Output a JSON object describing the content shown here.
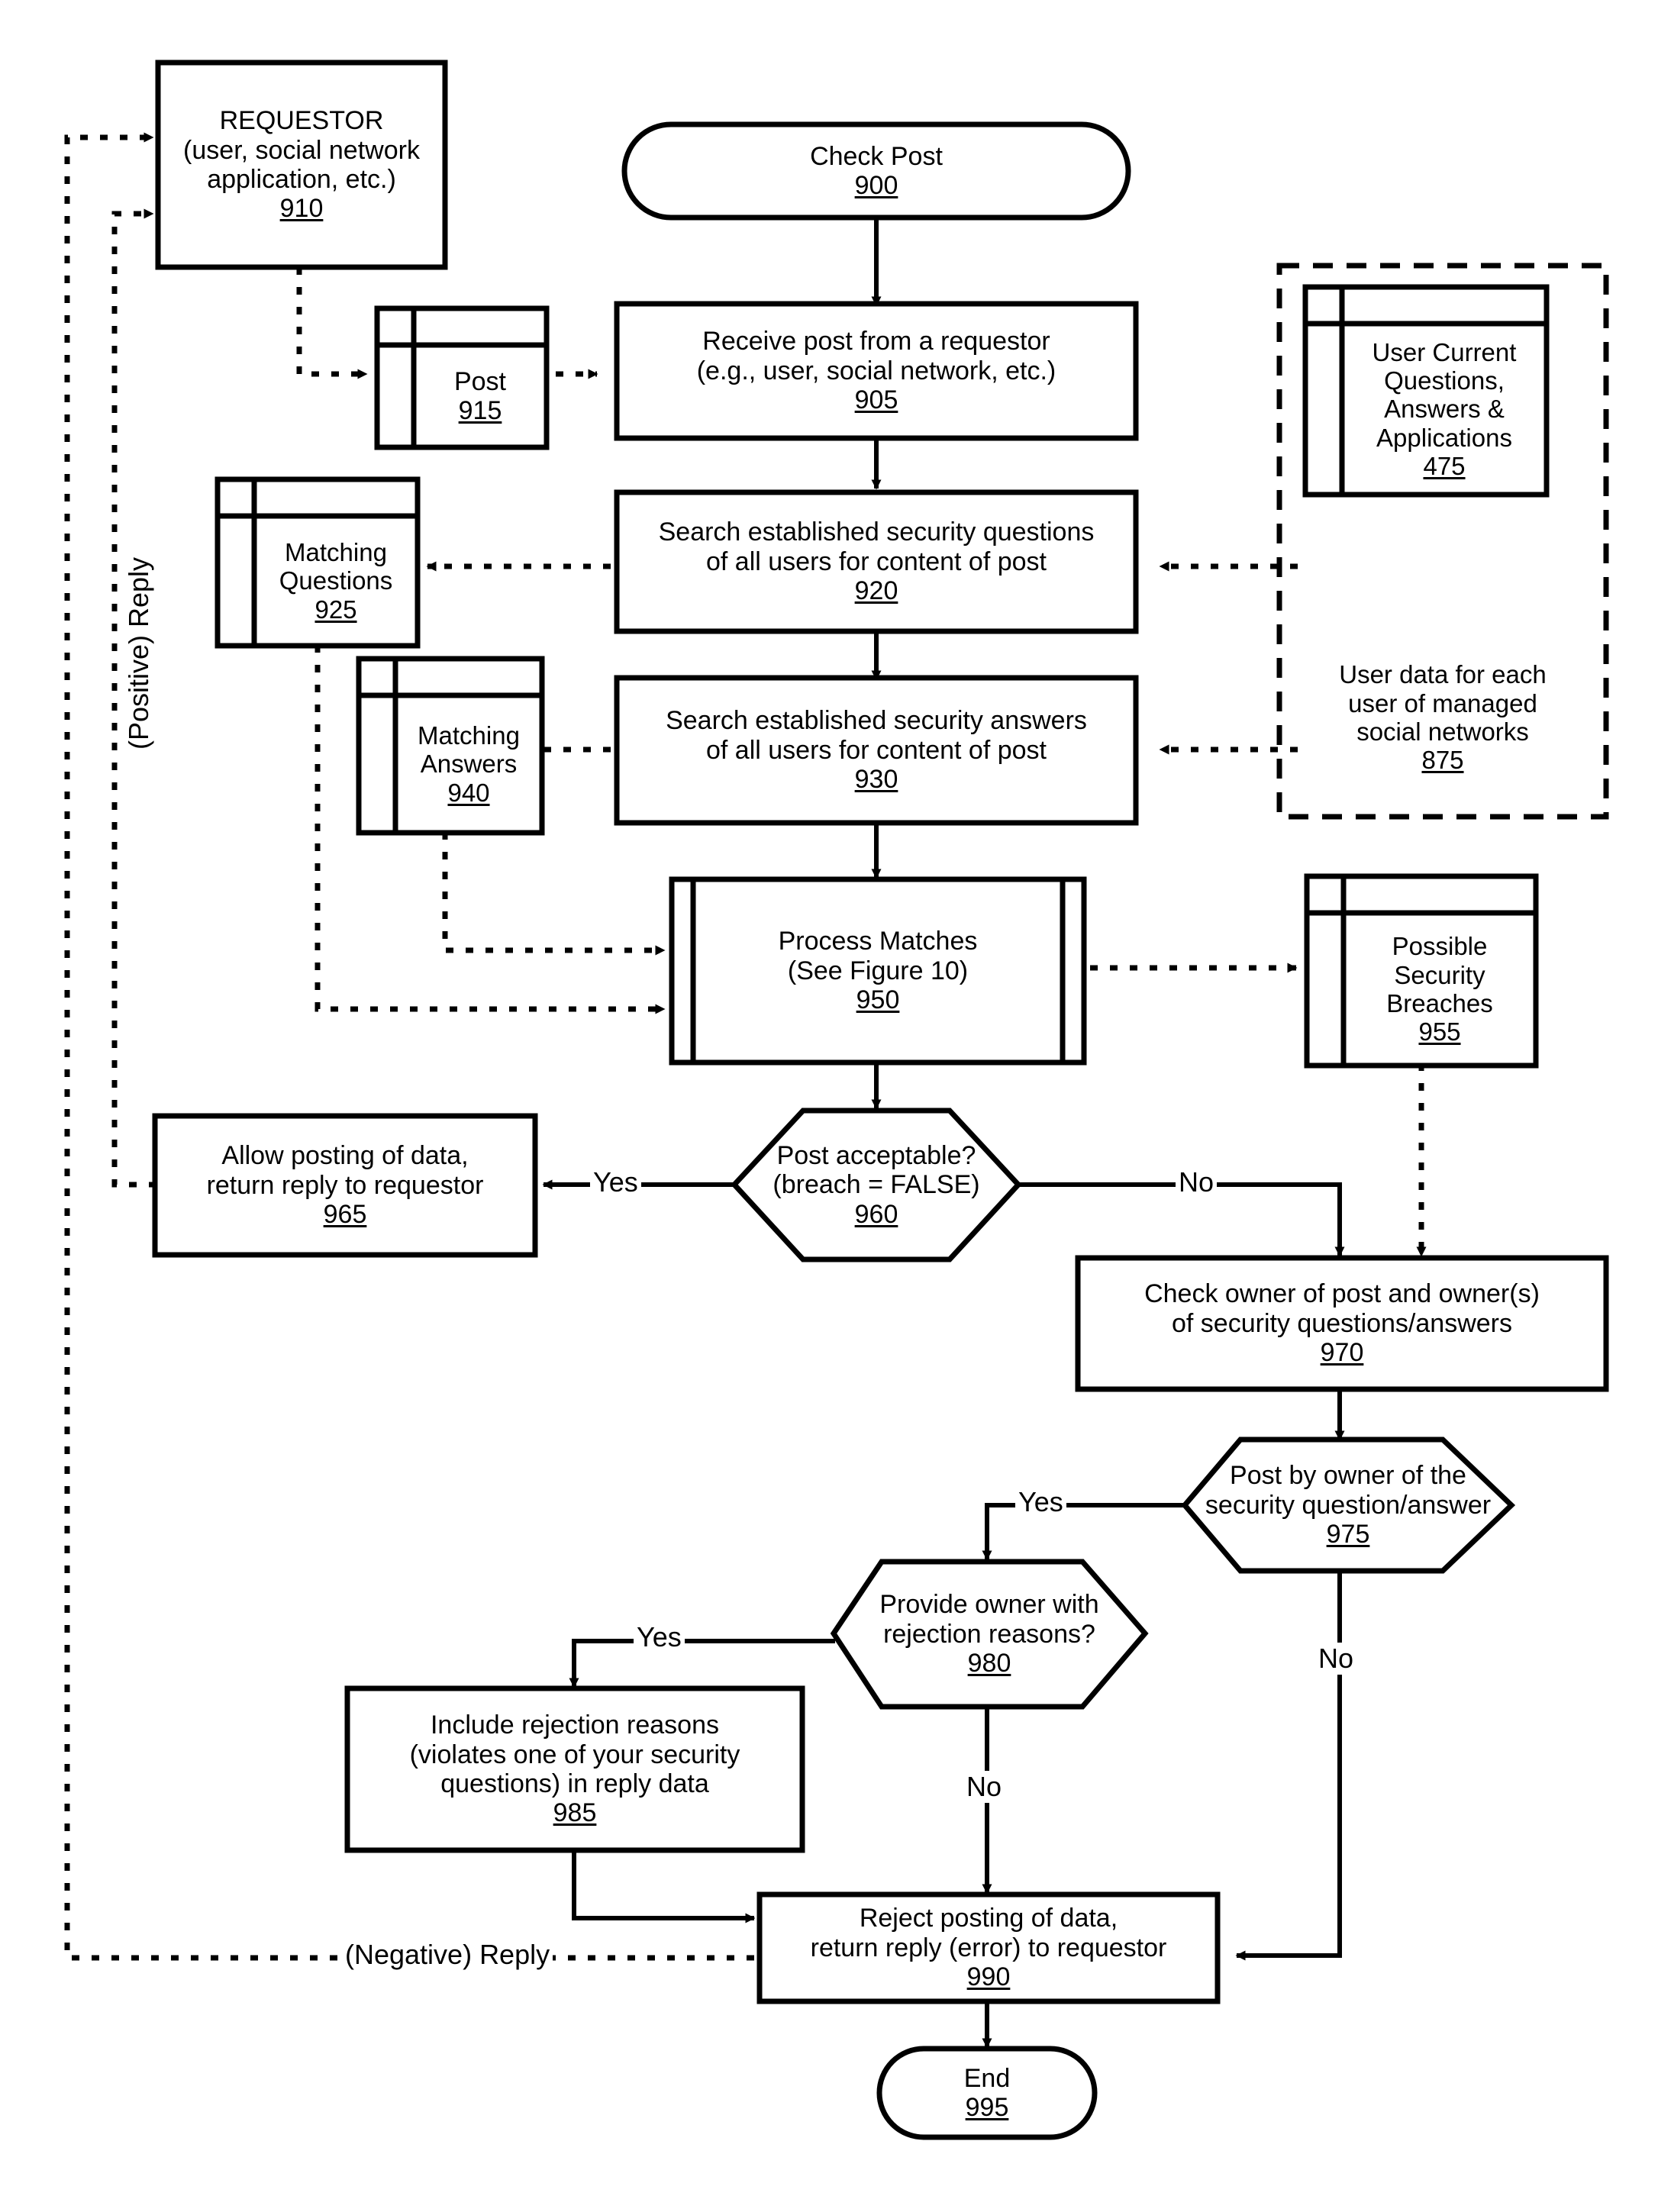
{
  "figure": {
    "title": "Check Post flowchart",
    "stroke_color": "#000000",
    "background_color": "#ffffff"
  },
  "nodes": {
    "requestor": {
      "shape": "process",
      "lines": [
        "REQUESTOR",
        "(user, social network",
        "application, etc.)"
      ],
      "ref": "910"
    },
    "check_post": {
      "shape": "terminator",
      "lines": [
        "Check Post"
      ],
      "ref": "900"
    },
    "post_store": {
      "shape": "datastore",
      "lines": [
        "Post"
      ],
      "ref": "915"
    },
    "receive_post": {
      "shape": "process",
      "lines": [
        "Receive post from a requestor",
        "(e.g., user, social network, etc.)"
      ],
      "ref": "905"
    },
    "user_current": {
      "shape": "datastore",
      "lines": [
        "User Current",
        "Questions,",
        "Answers &",
        "Applications"
      ],
      "ref": "475"
    },
    "user_data_group": {
      "shape": "dashed-group",
      "lines": [
        "User data for each",
        "user of managed",
        "social networks"
      ],
      "ref": "875"
    },
    "search_questions": {
      "shape": "process",
      "lines": [
        "Search established security questions",
        "of all users for content of post"
      ],
      "ref": "920"
    },
    "matching_questions": {
      "shape": "datastore",
      "lines": [
        "Matching",
        "Questions"
      ],
      "ref": "925"
    },
    "search_answers": {
      "shape": "process",
      "lines": [
        "Search established security answers",
        "of all users for content of post"
      ],
      "ref": "930"
    },
    "matching_answers": {
      "shape": "datastore",
      "lines": [
        "Matching",
        "Answers"
      ],
      "ref": "940"
    },
    "process_matches": {
      "shape": "predefined-process",
      "lines": [
        "Process Matches",
        "(See Figure 10)"
      ],
      "ref": "950"
    },
    "possible_breaches": {
      "shape": "datastore",
      "lines": [
        "Possible",
        "Security",
        "Breaches"
      ],
      "ref": "955"
    },
    "post_acceptable": {
      "shape": "decision-hex",
      "lines": [
        "Post acceptable?",
        "(breach = FALSE)"
      ],
      "ref": "960"
    },
    "allow_posting": {
      "shape": "process",
      "lines": [
        "Allow posting of data,",
        "return reply to requestor"
      ],
      "ref": "965"
    },
    "check_owner": {
      "shape": "process",
      "lines": [
        "Check owner of post and owner(s)",
        "of security questions/answers"
      ],
      "ref": "970"
    },
    "post_by_owner": {
      "shape": "decision-hex",
      "lines": [
        "Post by owner of the",
        "security question/answer"
      ],
      "ref": "975"
    },
    "provide_reasons": {
      "shape": "decision-hex",
      "lines": [
        "Provide owner with",
        "rejection reasons?"
      ],
      "ref": "980"
    },
    "include_reasons": {
      "shape": "process",
      "lines": [
        "Include rejection reasons",
        "(violates one of your security",
        "questions) in reply data"
      ],
      "ref": "985"
    },
    "reject_posting": {
      "shape": "process",
      "lines": [
        "Reject posting of data,",
        "return reply (error) to requestor"
      ],
      "ref": "990"
    },
    "end": {
      "shape": "terminator",
      "lines": [
        "End"
      ],
      "ref": "995"
    }
  },
  "edge_labels": {
    "positive_reply": "(Positive) Reply",
    "negative_reply": "(Negative) Reply",
    "yes_960": "Yes",
    "no_960": "No",
    "yes_975": "Yes",
    "no_975": "No",
    "yes_980": "Yes",
    "no_980": "No"
  }
}
